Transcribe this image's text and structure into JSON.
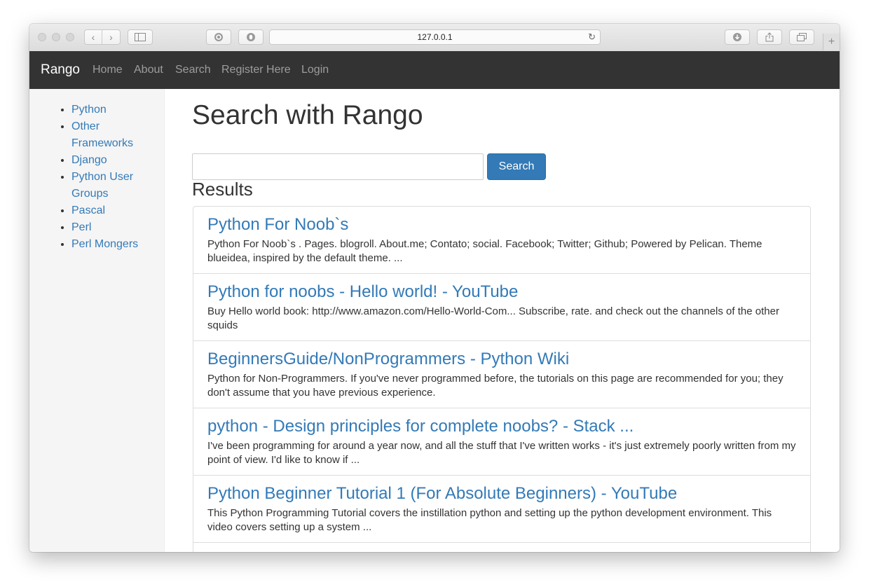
{
  "browser": {
    "address": "127.0.0.1"
  },
  "navbar": {
    "brand": "Rango",
    "links": [
      "Home",
      "About",
      "Search",
      "Register Here",
      "Login"
    ]
  },
  "sidebar": {
    "categories": [
      "Python",
      "Other Frameworks",
      "Django",
      "Python User Groups",
      "Pascal",
      "Perl",
      "Perl Mongers"
    ]
  },
  "main": {
    "title": "Search with Rango",
    "search": {
      "value": "",
      "button_label": "Search"
    },
    "results_heading": "Results",
    "results": [
      {
        "title": "Python For Noob`s",
        "snippet": "Python For Noob`s . Pages. blogroll. About.me; Contato; social. Facebook; Twitter; Github; Powered by Pelican. Theme blueidea, inspired by the default theme. ..."
      },
      {
        "title": "Python for noobs - Hello world! - YouTube",
        "snippet": "Buy Hello world book: http://www.amazon.com/Hello-World-Com... Subscribe, rate. and check out the channels of the other squids"
      },
      {
        "title": "BeginnersGuide/NonProgrammers - Python Wiki",
        "snippet": "Python for Non-Programmers. If you've never programmed before, the tutorials on this page are recommended for you; they don't assume that you have previous experience."
      },
      {
        "title": "python - Design principles for complete noobs? - Stack ...",
        "snippet": "I've been programming for around a year now, and all the stuff that I've written works - it's just extremely poorly written from my point of view. I'd like to know if ..."
      },
      {
        "title": "Python Beginner Tutorial 1 (For Absolute Beginners) - YouTube",
        "snippet": "This Python Programming Tutorial covers the instillation python and setting up the python development environment. This video covers setting up a system ..."
      }
    ]
  },
  "colors": {
    "link": "#337ab7",
    "navbar_bg": "#333333",
    "sidebar_bg": "#f5f5f5"
  }
}
